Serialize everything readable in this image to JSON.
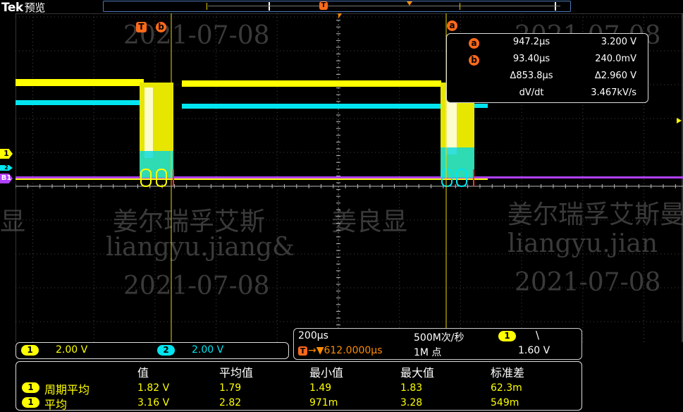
{
  "header": {
    "brand": "Tek",
    "mode": "预览",
    "record_bar_trigger": "T"
  },
  "cursor_markers": {
    "t_label": "T",
    "a_label": "a",
    "b_label": "b"
  },
  "cursor_readout": {
    "a_label": "a",
    "b_label": "b",
    "a_time": "947.2μs",
    "a_volt": "3.200 V",
    "b_time": "93.40μs",
    "b_volt": "240.0mV",
    "delta_time": "Δ853.8μs",
    "delta_volt": "Δ2.960 V",
    "slope_label": "dV/dt",
    "slope_value": "3.467kV/s"
  },
  "left_markers": {
    "ch1": "1",
    "ch2": "2",
    "bus": "B1"
  },
  "channels": {
    "ch1_badge": "1",
    "ch1_scale": "2.00 V",
    "ch2_badge": "2",
    "ch2_scale": "2.00 V"
  },
  "acquisition": {
    "timebase": "200μs",
    "sample_rate": "500M次/秒",
    "trigger_badge": "1",
    "trigger_slope": "\\",
    "trigger_position_icon": "T",
    "trigger_position": "→▼612.0000μs",
    "record_length": "1M 点",
    "trigger_level": "1.60 V"
  },
  "measurements": {
    "headers": [
      "值",
      "平均值",
      "最小值",
      "最大值",
      "标准差"
    ],
    "rows": [
      {
        "badge": "1",
        "label": "周期平均",
        "values": [
          "1.82 V",
          "1.79",
          "1.49",
          "1.83",
          "62.3m"
        ]
      },
      {
        "badge": "1",
        "label": "平均",
        "values": [
          "3.16 V",
          "2.82",
          "971m",
          "3.28",
          "549m"
        ]
      }
    ]
  },
  "watermark": {
    "name1": "姜尔瑞孚艾斯",
    "name2": "姜尔瑞孚艾斯曼",
    "mid": "姜良显",
    "left_frag": "显",
    "email1": "liangyu.jiang&",
    "email2": "liangyu.jian",
    "date": "2021-07-08"
  },
  "colors": {
    "ch1": "#ffff00",
    "ch2": "#00e5f0",
    "bus": "#b040ff",
    "cursor": "#ff6a1a",
    "cursor_line": "#e8d800"
  }
}
